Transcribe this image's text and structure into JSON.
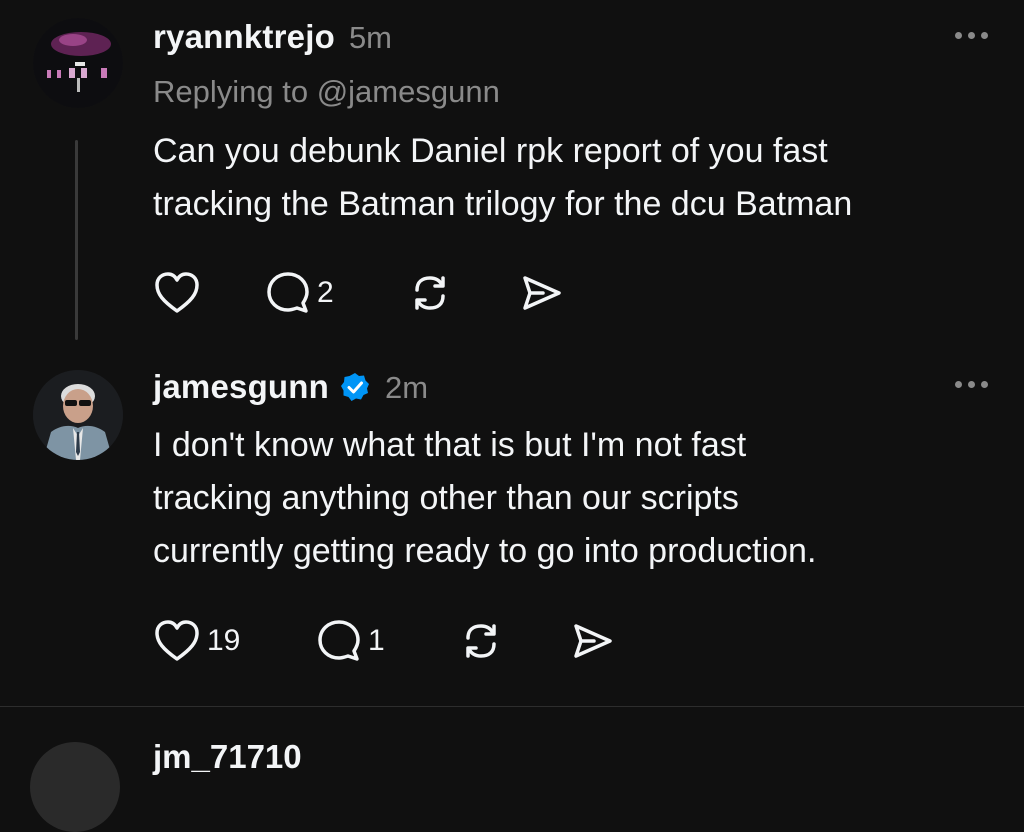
{
  "posts": [
    {
      "username": "ryannktrejo",
      "time": "5m",
      "replying_to": "Replying to @jamesgunn",
      "text_lines": [
        "Can you debunk Daniel rpk report of you fast",
        "tracking the Batman trilogy for the dcu Batman"
      ],
      "verified": false,
      "actions": {
        "like_count": "",
        "reply_count": "2",
        "repost_label": "",
        "share_label": ""
      },
      "icons": [
        "heart-icon",
        "comment-icon",
        "repost-icon",
        "share-icon",
        "more-icon"
      ]
    },
    {
      "username": "jamesgunn",
      "time": "2m",
      "verified": true,
      "text_lines": [
        "I don't know what that is but I'm not fast",
        "tracking anything other than our scripts",
        "currently getting ready to go into production."
      ],
      "actions": {
        "like_count": "19",
        "reply_count": "1",
        "repost_label": "",
        "share_label": ""
      },
      "icons": [
        "heart-icon",
        "comment-icon",
        "repost-icon",
        "share-icon",
        "more-icon"
      ]
    }
  ],
  "next_post": {
    "username_partial": "jm_71710"
  },
  "colors": {
    "background": "#101010",
    "text_primary": "#f3f5f7",
    "text_secondary": "#8a8a8a",
    "verified_blue": "#0095f6",
    "thread_line": "#3a3a3a"
  }
}
